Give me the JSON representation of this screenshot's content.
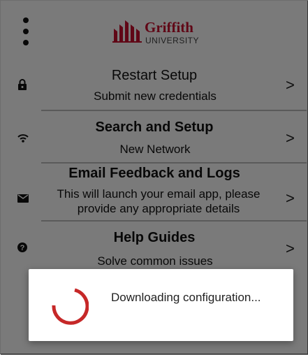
{
  "header": {
    "menu_icon": "kebab-menu-icon",
    "logo": {
      "name": "Griffith",
      "subname": "UNIVERSITY",
      "color": "#c8102e"
    }
  },
  "menu": {
    "items": [
      {
        "title": "Restart Setup",
        "subtitle": "Submit new credentials",
        "icon": "lock-icon"
      },
      {
        "title": "Search and Setup",
        "subtitle": "New Network",
        "icon": "wifi-icon"
      },
      {
        "title": "Email Feedback and Logs",
        "subtitle": "This will launch your email app, please provide any appropriate details",
        "icon": "mail-icon"
      },
      {
        "title": "Help Guides",
        "subtitle": "Solve common issues",
        "icon": "help-icon"
      }
    ],
    "chevron": ">"
  },
  "dialog": {
    "message": "Downloading configuration...",
    "spinner_color": "#c62828"
  }
}
